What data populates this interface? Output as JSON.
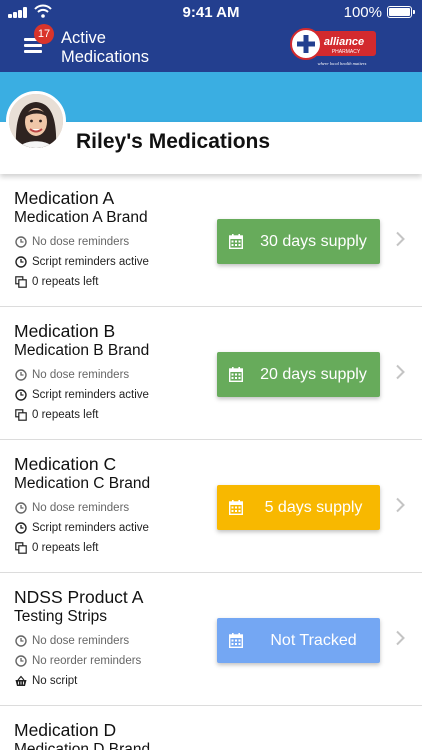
{
  "status_bar": {
    "time": "9:41 AM",
    "battery": "100%"
  },
  "header": {
    "title": "Active Medications",
    "notification_count": "17",
    "logo_text": "alliance",
    "logo_subtext": "PHARMACY",
    "logo_tagline": "where local health matters"
  },
  "patient": {
    "name": "Riley's Medications"
  },
  "colors": {
    "navy": "#233f8f",
    "sky": "#3aaee2",
    "green": "#67ab5b",
    "amber": "#f8b800",
    "blue": "#74a7f3"
  },
  "medications": [
    {
      "name": "Medication A",
      "brand": "Medication A Brand",
      "lines": [
        {
          "icon": "clock-icon",
          "text": "No dose reminders",
          "muted": true
        },
        {
          "icon": "clock-icon",
          "text": "Script reminders active",
          "muted": false
        },
        {
          "icon": "copy-icon",
          "text": "0 repeats left",
          "muted": false
        }
      ],
      "supply": "30 days supply",
      "supply_color": "#67ab5b"
    },
    {
      "name": "Medication B",
      "brand": "Medication B Brand",
      "lines": [
        {
          "icon": "clock-icon",
          "text": "No dose reminders",
          "muted": true
        },
        {
          "icon": "clock-icon",
          "text": "Script reminders active",
          "muted": false
        },
        {
          "icon": "copy-icon",
          "text": "0 repeats left",
          "muted": false
        }
      ],
      "supply": "20 days supply",
      "supply_color": "#67ab5b"
    },
    {
      "name": "Medication C",
      "brand": "Medication C Brand",
      "lines": [
        {
          "icon": "clock-icon",
          "text": "No dose reminders",
          "muted": true
        },
        {
          "icon": "clock-icon",
          "text": "Script reminders active",
          "muted": false
        },
        {
          "icon": "copy-icon",
          "text": "0 repeats left",
          "muted": false
        }
      ],
      "supply": "5 days supply",
      "supply_color": "#f8b800"
    },
    {
      "name": "NDSS Product A",
      "brand": "Testing Strips",
      "lines": [
        {
          "icon": "clock-icon",
          "text": "No dose reminders",
          "muted": true
        },
        {
          "icon": "clock-icon",
          "text": "No reorder reminders",
          "muted": true
        },
        {
          "icon": "basket-icon",
          "text": "No script",
          "muted": false
        }
      ],
      "supply": "Not Tracked",
      "supply_color": "#74a7f3"
    },
    {
      "name": "Medication D",
      "brand": "Medication D Brand"
    }
  ]
}
